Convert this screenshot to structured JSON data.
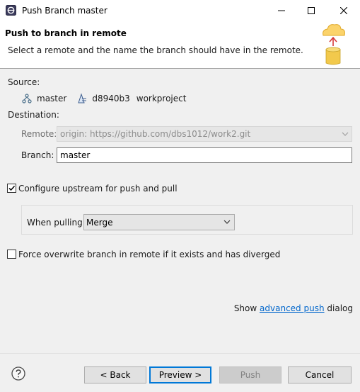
{
  "window": {
    "title": "Push Branch master"
  },
  "banner": {
    "title": "Push to branch in remote",
    "description": "Select a remote and the name the branch should have in the remote."
  },
  "source": {
    "label": "Source:",
    "branch": "master",
    "commit": "d8940b3",
    "project": "workproject"
  },
  "destination": {
    "label": "Destination:",
    "remote_label": "Remote:",
    "remote_value": "origin: https://github.com/dbs1012/work2.git",
    "branch_label": "Branch:",
    "branch_value": "master"
  },
  "upstream": {
    "label": "Configure upstream for push and pull",
    "checked": true,
    "when_pulling_label": "When pulling:",
    "when_pulling_value": "Merge"
  },
  "force": {
    "label": "Force overwrite branch in remote if it exists and has diverged",
    "checked": false
  },
  "advanced": {
    "prefix": "Show",
    "link": "advanced push",
    "suffix": "dialog"
  },
  "buttons": {
    "back": "< Back",
    "preview": "Preview >",
    "push": "Push",
    "cancel": "Cancel"
  }
}
